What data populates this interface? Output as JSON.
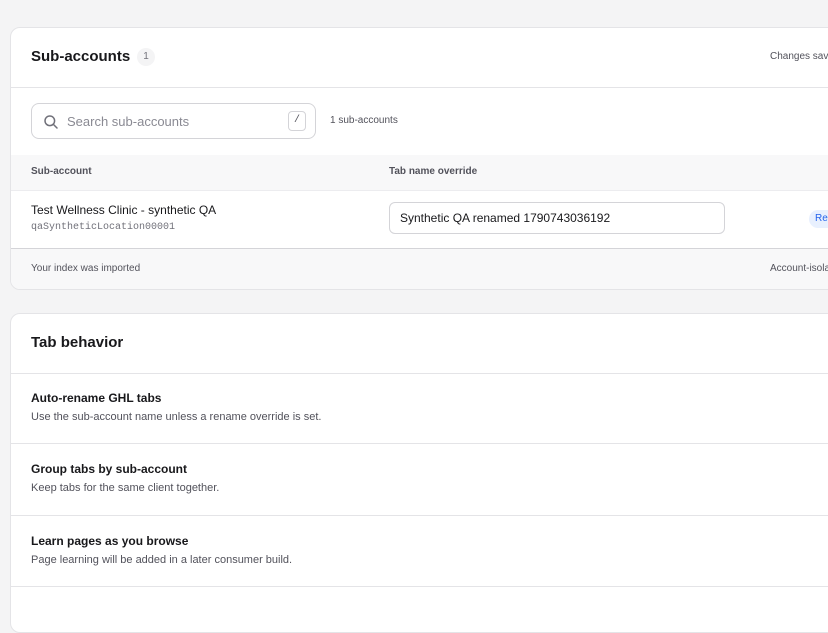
{
  "subaccounts_card": {
    "title": "Sub-accounts",
    "count_badge": "1",
    "status_text": "Changes saved",
    "search": {
      "placeholder": "Search sub-accounts",
      "value": "",
      "shortcut": "/",
      "result_count": "1 sub-accounts"
    },
    "table": {
      "columns": [
        "Sub-account",
        "Tab name override"
      ],
      "rows": [
        {
          "name": "Test Wellness Clinic - synthetic QA",
          "location_id": "qaSyntheticLocation00001",
          "tab_name_override": "Synthetic QA renamed 1790743036192",
          "badge": "Renamed"
        }
      ]
    },
    "footer": {
      "left": "Your index was imported",
      "right": "Account-isolated"
    }
  },
  "tab_behavior_card": {
    "title": "Tab behavior",
    "settings": [
      {
        "title": "Auto-rename GHL tabs",
        "description": "Use the sub-account name unless a rename override is set."
      },
      {
        "title": "Group tabs by sub-account",
        "description": "Keep tabs for the same client together."
      },
      {
        "title": "Learn pages as you browse",
        "description": "Page learning will be added in a later consumer build."
      }
    ]
  },
  "colors": {
    "background": "#f4f4f5",
    "card": "#ffffff",
    "border": "#e4e4e7",
    "badge_blue_bg": "#e8f0fe",
    "badge_blue_text": "#2563eb"
  }
}
